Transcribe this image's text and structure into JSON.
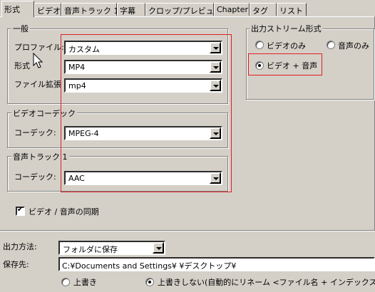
{
  "tabs": [
    "形式",
    "ビデオ",
    "音声トラック 1",
    "字幕",
    "クロップ/プレビュー",
    "Chapter",
    "タグ",
    "リスト"
  ],
  "active_tab": "形式",
  "general": {
    "title": "一般",
    "profile_label": "プロファイル:",
    "profile_value": "カスタム",
    "format_label": "形式",
    "format_value": "MP4",
    "ext_label": "ファイル拡張",
    "ext_value": "mp4"
  },
  "video_codec": {
    "title": "ビデオコーデック",
    "codec_label": "コーデック:",
    "codec_value": "MPEG-4"
  },
  "audio_track": {
    "title": "音声トラック 1",
    "codec_label": "コーデック:",
    "codec_value": "AAC"
  },
  "stream_format": {
    "title": "出力ストリーム形式",
    "options": [
      "ビデオのみ",
      "音声のみ",
      "ビデオ + 音声"
    ],
    "selected": "ビデオ + 音声"
  },
  "sync": {
    "label": "ビデオ / 音声の同期",
    "checked": true
  },
  "output": {
    "method_label": "出力方法:",
    "method_value": "フォルダに保存",
    "dest_label": "保存先:",
    "dest_value": "C:¥Documents and Settings¥          ¥デスクトップ¥",
    "overwrite_label": "上書き",
    "no_overwrite_label": "上書きしない(自動的にリネーム <ファイル名 + インデックス>)"
  },
  "colors": {
    "highlight": "#e02020",
    "face": "#d4d0c8"
  }
}
